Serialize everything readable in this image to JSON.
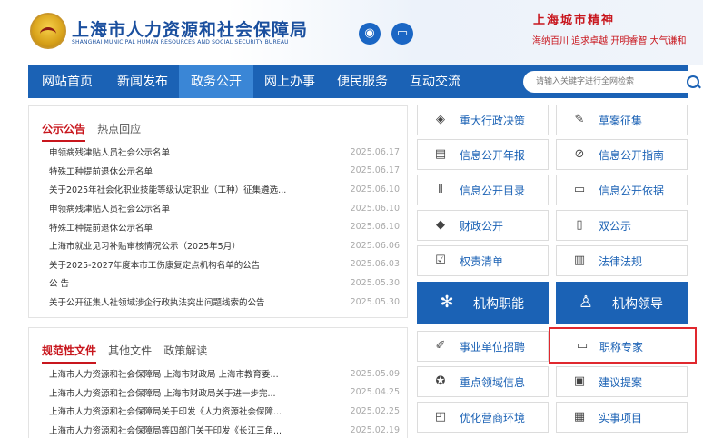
{
  "header": {
    "title": "上海市人力资源和社会保障局",
    "subtitle": "SHANGHAI MUNICIPAL HUMAN RESOURCES AND SOCIAL SECURITY BUREAU",
    "spirit_title": "上海城市精神",
    "spirit_text": "海纳百川 追求卓越 开明睿智 大气谦和",
    "social": [
      "weibo-icon",
      "wechat-icon"
    ]
  },
  "nav": {
    "items": [
      "网站首页",
      "新闻发布",
      "政务公开",
      "网上办事",
      "便民服务",
      "互动交流"
    ],
    "active": "政务公开",
    "search_placeholder": "请输入关键字进行全网检索"
  },
  "notice": {
    "tabs": [
      "公示公告",
      "热点回应"
    ],
    "items": [
      {
        "title": "申领病残津贴人员社会公示名单",
        "date": "2025.06.17"
      },
      {
        "title": "特殊工种提前退休公示名单",
        "date": "2025.06.17"
      },
      {
        "title": "关于2025年社会化职业技能等级认定职业（工种）征集遴选...",
        "date": "2025.06.10"
      },
      {
        "title": "申领病残津贴人员社会公示名单",
        "date": "2025.06.10"
      },
      {
        "title": "特殊工种提前退休公示名单",
        "date": "2025.06.10"
      },
      {
        "title": "上海市就业见习补贴审核情况公示（2025年5月）",
        "date": "2025.06.06"
      },
      {
        "title": "关于2025-2027年度本市工伤康复定点机构名单的公告",
        "date": "2025.06.03"
      },
      {
        "title": "公 告",
        "date": "2025.05.30"
      },
      {
        "title": "关于公开征集人社领域涉企行政执法突出问题线索的公告",
        "date": "2025.05.30"
      }
    ]
  },
  "policy": {
    "tabs": [
      "规范性文件",
      "其他文件",
      "政策解读"
    ],
    "items": [
      {
        "title": "上海市人力资源和社会保障局 上海市财政局 上海市教育委...",
        "date": "2025.05.09"
      },
      {
        "title": "上海市人力资源和社会保障局 上海市财政局关于进一步完...",
        "date": "2025.04.25"
      },
      {
        "title": "上海市人力资源和社会保障局关于印发《人力资源社会保障...",
        "date": "2025.02.25"
      },
      {
        "title": "上海市人力资源和社会保障局等四部门关于印发《长江三角...",
        "date": "2025.02.19"
      }
    ]
  },
  "buttons": {
    "b1": {
      "label": "重大行政决策",
      "icon": "layers-icon"
    },
    "b2": {
      "label": "草案征集",
      "icon": "pen-icon"
    },
    "b3": {
      "label": "信息公开年报",
      "icon": "document-icon"
    },
    "b4": {
      "label": "信息公开指南",
      "icon": "compass-icon"
    },
    "b5": {
      "label": "信息公开目录",
      "icon": "bar-chart-icon"
    },
    "b6": {
      "label": "信息公开依据",
      "icon": "monitor-icon"
    },
    "b7": {
      "label": "财政公开",
      "icon": "money-icon"
    },
    "b8": {
      "label": "双公示",
      "icon": "page-icon"
    },
    "b9": {
      "label": "权责清单",
      "icon": "checklist-icon"
    },
    "b10": {
      "label": "法律法规",
      "icon": "book-icon"
    },
    "b11": {
      "label": "机构职能",
      "icon": "org-icon"
    },
    "b12": {
      "label": "机构领导",
      "icon": "leaders-icon"
    },
    "b13": {
      "label": "事业单位招聘",
      "icon": "edit-icon"
    },
    "b14": {
      "label": "职称专家",
      "icon": "screen-icon"
    },
    "b15": {
      "label": "重点领域信息",
      "icon": "star-icon"
    },
    "b16": {
      "label": "建议提案",
      "icon": "board-icon"
    },
    "b17": {
      "label": "优化营商环境",
      "icon": "frame-icon"
    },
    "b18": {
      "label": "实事项目",
      "icon": "calendar-icon"
    }
  },
  "colors": {
    "primary": "#1b62b5",
    "accent": "#c8161d",
    "highlight": "#e0282e"
  }
}
